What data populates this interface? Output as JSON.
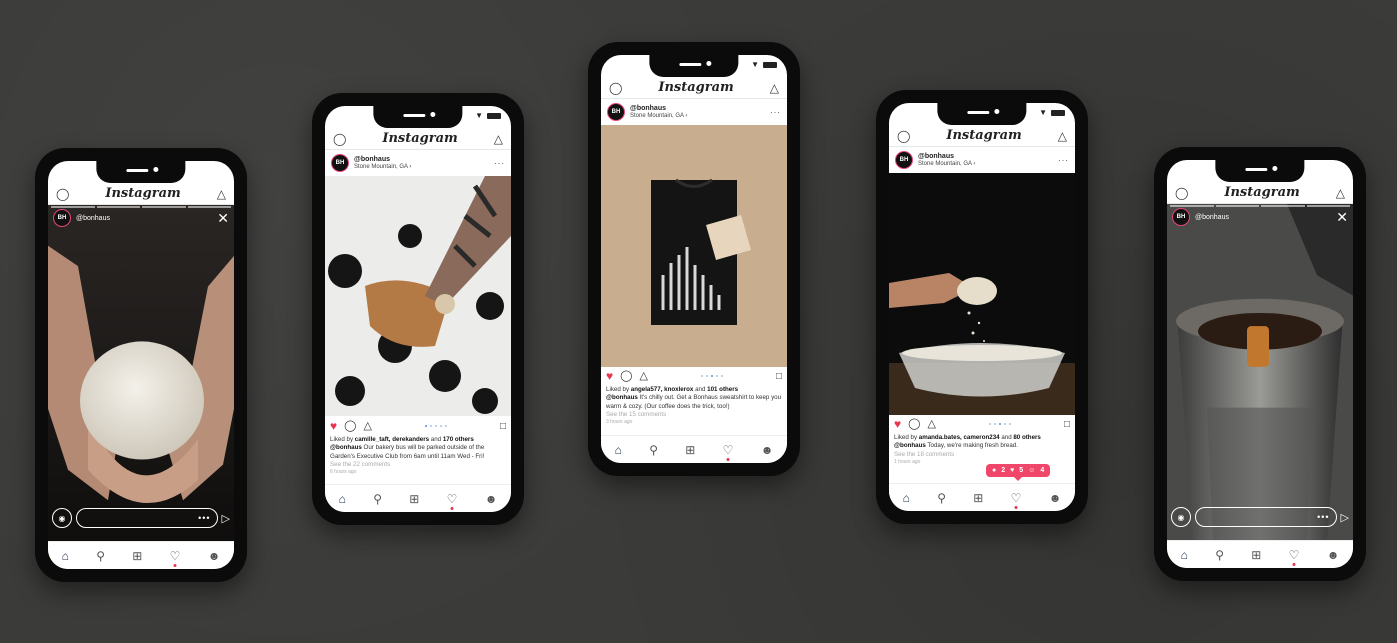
{
  "app": {
    "title": "Instagram",
    "username": "@bonhaus",
    "location": "Stone Mountain, GA ›",
    "avatar_text": "BH"
  },
  "phones": [
    {
      "kind": "story",
      "user": "@bonhaus",
      "reply_dots": "•••"
    },
    {
      "kind": "post",
      "liked_by_prefix": "Liked by ",
      "liked_names": "camille_taft, derekanders",
      "liked_and": " and ",
      "liked_count": "170 others",
      "caption_user": "@bonhaus",
      "caption_text": " Our bakery bus will be parked outside of the Garden's Executive Club from 6am until 11am Wed - Fri!",
      "comments": "See the 22 comments",
      "time": "6 hours ago"
    },
    {
      "kind": "post",
      "liked_by_prefix": "Liked by ",
      "liked_names": "angela577, knoxlerox",
      "liked_and": " and ",
      "liked_count": "101 others",
      "caption_user": "@bonhaus",
      "caption_text": " It's chilly out. Get a Bonhaus sweatshirt to keep you warm & cozy. (Our coffee does the trick, too!)",
      "comments": "See the 15 comments",
      "time": "3 hours ago"
    },
    {
      "kind": "post",
      "liked_by_prefix": "Liked by ",
      "liked_names": "amanda.bates, cameron234",
      "liked_and": " and ",
      "liked_count": "80 others",
      "caption_user": "@bonhaus",
      "caption_text": " Today, we're making fresh bread.",
      "comments": "See the 18 comments",
      "time": "1 hours ago",
      "notification": {
        "comments": "2",
        "likes": "5",
        "follows": "4"
      }
    },
    {
      "kind": "story",
      "user": "@bonhaus",
      "reply_dots": "•••"
    }
  ],
  "colors": {
    "accent": "#e8364f",
    "notification": "#f0466a",
    "background": "#3b3b39"
  }
}
